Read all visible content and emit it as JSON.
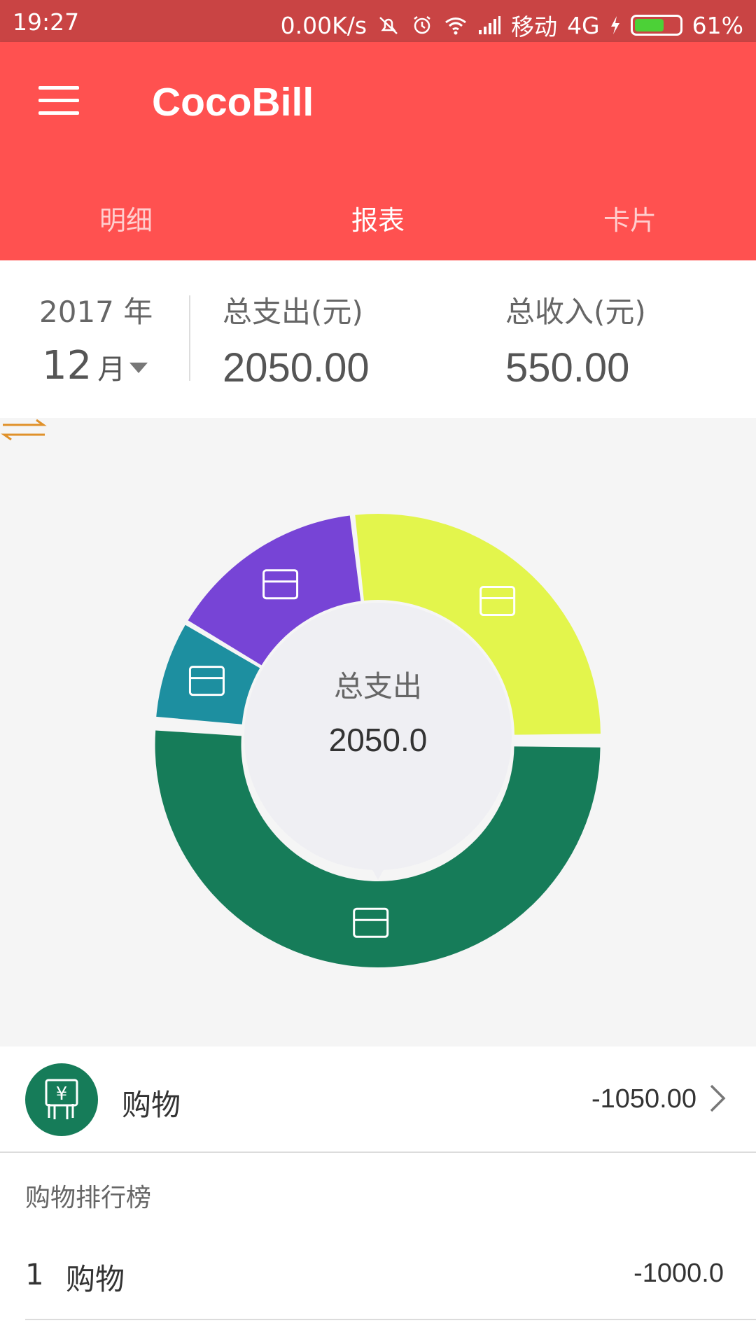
{
  "status_bar": {
    "time": "19:27",
    "network_speed": "0.00K/s",
    "carrier": "移动",
    "network_type": "4G",
    "battery_percent": "61%",
    "battery_level": 0.61,
    "icons": [
      "silent-icon",
      "alarm-icon",
      "wifi-icon",
      "signal-icon",
      "charging-icon",
      "battery-icon"
    ]
  },
  "app_bar": {
    "title": "CocoBill",
    "tabs": [
      {
        "label": "明细",
        "active": false
      },
      {
        "label": "报表",
        "active": true
      },
      {
        "label": "卡片",
        "active": false
      }
    ],
    "color": "#ff5150"
  },
  "summary": {
    "year": "2017 年",
    "month": "12",
    "month_unit": "月",
    "expense_label": "总支出(元)",
    "expense_value": "2050.00",
    "income_label": "总收入(元)",
    "income_value": "550.00"
  },
  "chart_data": {
    "type": "pie",
    "center_label": "总支出",
    "center_value": "2050.0",
    "slices": [
      {
        "value": 1050,
        "color": "#167c59",
        "icon": "shopping-icon",
        "selected": true
      },
      {
        "value": 150,
        "color": "#1d8fa0",
        "icon": "violation-icon"
      },
      {
        "value": 300,
        "color": "#7744d6",
        "icon": "medical-icon"
      },
      {
        "value": 550,
        "color": "#e3f54c",
        "icon": "gift-icon"
      }
    ]
  },
  "selected_category": {
    "name": "购物",
    "amount": "-1050.00",
    "color": "#167c59",
    "icon": "shopping-icon"
  },
  "ranking": {
    "title": "购物排行榜",
    "items": [
      {
        "index": "1",
        "name": "购物",
        "value": "-1000.0"
      }
    ]
  }
}
